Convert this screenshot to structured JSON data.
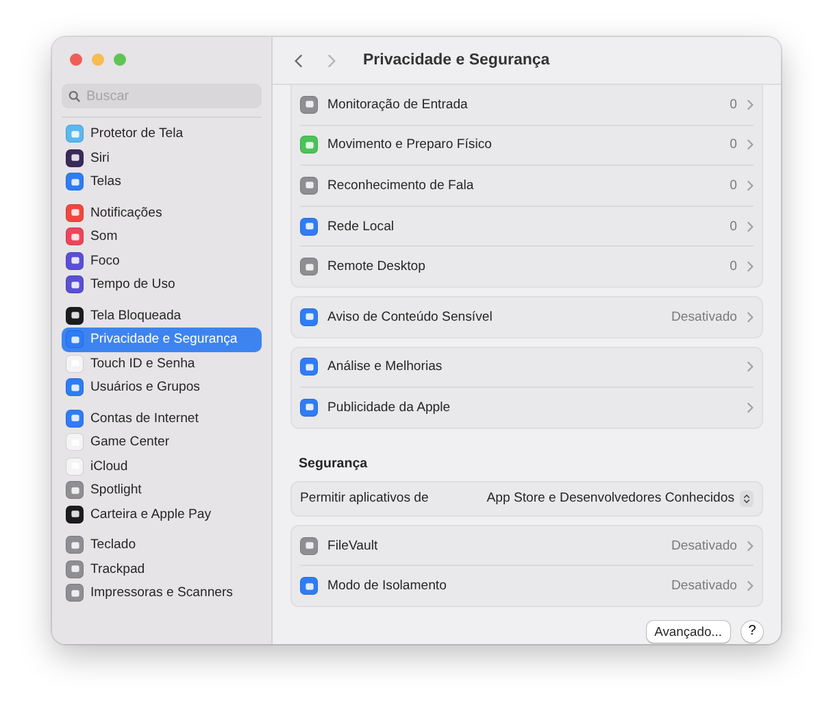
{
  "sidebar": {
    "search": {
      "placeholder": "Buscar"
    },
    "groups": [
      {
        "items": [
          {
            "label": "Protetor de Tela",
            "selected": false,
            "color": "#5ab8f0"
          },
          {
            "label": "Siri",
            "selected": false,
            "color": "#3a2a5a"
          },
          {
            "label": "Telas",
            "selected": false,
            "color": "#2f7cf6"
          }
        ]
      },
      {
        "items": [
          {
            "label": "Notificações",
            "selected": false,
            "color": "#f0483e"
          },
          {
            "label": "Som",
            "selected": false,
            "color": "#f0445a"
          },
          {
            "label": "Foco",
            "selected": false,
            "color": "#5a4fd6"
          },
          {
            "label": "Tempo de Uso",
            "selected": false,
            "color": "#5a4fd6"
          }
        ]
      },
      {
        "items": [
          {
            "label": "Tela Bloqueada",
            "selected": false,
            "color": "#1c1c1e"
          },
          {
            "label": "Privacidade e Segurança",
            "selected": true,
            "color": "#2f7cf6"
          },
          {
            "label": "Touch ID e Senha",
            "selected": false,
            "color": "#f4f4f4"
          },
          {
            "label": "Usuários e Grupos",
            "selected": false,
            "color": "#2f7cf6"
          }
        ]
      },
      {
        "items": [
          {
            "label": "Contas de Internet",
            "selected": false,
            "color": "#2f7cf6"
          },
          {
            "label": "Game Center",
            "selected": false,
            "color": "#f4f4f4"
          },
          {
            "label": "iCloud",
            "selected": false,
            "color": "#f4f4f4"
          },
          {
            "label": "Spotlight",
            "selected": false,
            "color": "#8e8e93"
          },
          {
            "label": "Carteira e Apple Pay",
            "selected": false,
            "color": "#1c1c1e"
          }
        ]
      },
      {
        "items": [
          {
            "label": "Teclado",
            "selected": false,
            "color": "#8e8e93"
          },
          {
            "label": "Trackpad",
            "selected": false,
            "color": "#8e8e93"
          },
          {
            "label": "Impressoras e Scanners",
            "selected": false,
            "color": "#8e8e93"
          }
        ]
      }
    ]
  },
  "header": {
    "title": "Privacidade e Segurança"
  },
  "sections": [
    {
      "kind": "card",
      "rows": [
        {
          "label": "Monitoração de Entrada",
          "value": "0",
          "color": "#8e8e93"
        },
        {
          "label": "Movimento e Preparo Físico",
          "value": "0",
          "color": "#4cc35a"
        },
        {
          "label": "Reconhecimento de Fala",
          "value": "0",
          "color": "#8e8e93"
        },
        {
          "label": "Rede Local",
          "value": "0",
          "color": "#2f7cf6"
        },
        {
          "label": "Remote Desktop",
          "value": "0",
          "color": "#8e8e93"
        }
      ]
    },
    {
      "kind": "card",
      "rows": [
        {
          "label": "Aviso de Conteúdo Sensível",
          "value": "Desativado",
          "color": "#2f7cf6"
        }
      ]
    },
    {
      "kind": "card",
      "rows": [
        {
          "label": "Análise e Melhorias",
          "color": "#2f7cf6"
        },
        {
          "label": "Publicidade da Apple",
          "color": "#2f7cf6"
        }
      ]
    },
    {
      "kind": "heading",
      "text": "Segurança"
    },
    {
      "kind": "popup",
      "label": "Permitir aplicativos de",
      "value": "App Store e Desenvolvedores Conhecidos"
    },
    {
      "kind": "card",
      "rows": [
        {
          "label": "FileVault",
          "value": "Desativado",
          "color": "#8e8e93"
        },
        {
          "label": "Modo de Isolamento",
          "value": "Desativado",
          "color": "#2f7cf6"
        }
      ]
    }
  ],
  "footer": {
    "button": "Avançado...",
    "help": "?"
  }
}
